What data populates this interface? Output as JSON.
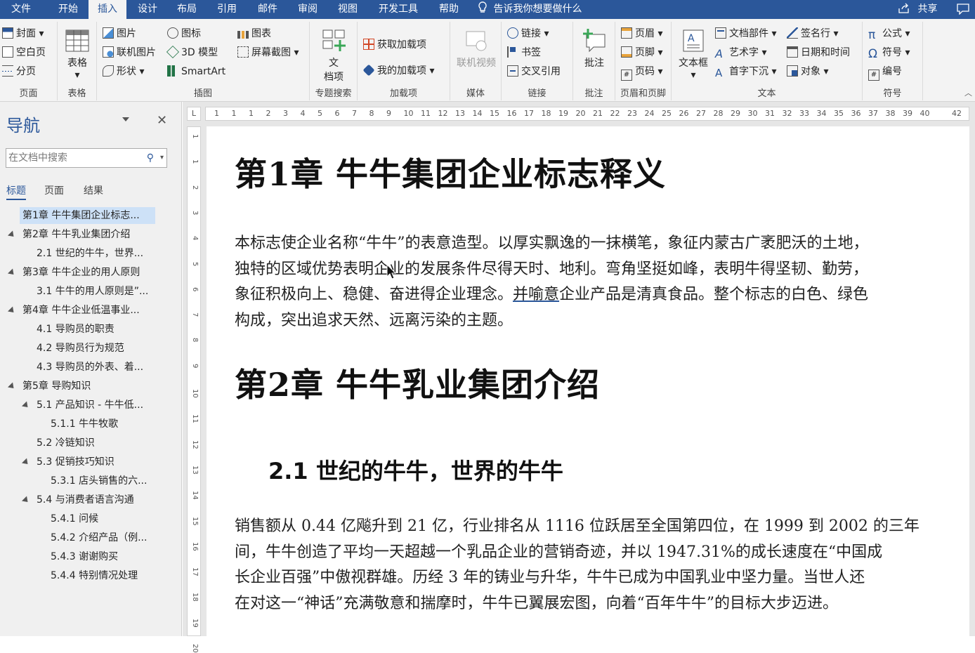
{
  "tabs": [
    {
      "label": "文件"
    },
    {
      "label": "开始"
    },
    {
      "label": "插入"
    },
    {
      "label": "设计"
    },
    {
      "label": "布局"
    },
    {
      "label": "引用"
    },
    {
      "label": "邮件"
    },
    {
      "label": "审阅"
    },
    {
      "label": "视图"
    },
    {
      "label": "开发工具"
    },
    {
      "label": "帮助"
    }
  ],
  "tell_me": "告诉我你想要做什么",
  "share": "共享",
  "ribbon": {
    "pages": {
      "cover": "封面",
      "blank": "空白页",
      "break": "分页",
      "label": "页面"
    },
    "tables": {
      "table": "表格",
      "label": "表格"
    },
    "illustrations": {
      "picture": "图片",
      "online_picture": "联机图片",
      "shapes": "形状",
      "icons": "图标",
      "model3d": "3D 模型",
      "smartart": "SmartArt",
      "chart": "图表",
      "screenshot": "屏幕截图",
      "label": "插图"
    },
    "topic": {
      "doc_item": "文档项",
      "doc_item_line1": "文",
      "doc_item_line2": "档项",
      "label": "专题搜索"
    },
    "addins": {
      "get": "获取加载项",
      "my": "我的加载项",
      "label": "加载项"
    },
    "media": {
      "online_video": "联机视频",
      "label": "媒体"
    },
    "links": {
      "link": "链接",
      "bookmark": "书签",
      "cross_ref": "交叉引用",
      "label": "链接"
    },
    "comments": {
      "comment": "批注",
      "label": "批注"
    },
    "header_footer": {
      "header": "页眉",
      "footer": "页脚",
      "page_number": "页码",
      "label": "页眉和页脚"
    },
    "text": {
      "textbox": "文本框",
      "quick_parts": "文档部件",
      "wordart": "艺术字",
      "dropcap": "首字下沉",
      "signature": "签名行",
      "datetime": "日期和时间",
      "object": "对象",
      "label": "文本"
    },
    "symbols": {
      "equation": "公式",
      "symbol": "符号",
      "number": "编号",
      "label": "符号"
    }
  },
  "nav": {
    "title": "导航",
    "search_placeholder": "在文档中搜索",
    "tabs": [
      "标题",
      "页面",
      "结果"
    ],
    "items": [
      {
        "label": "第1章 牛牛集团企业标志...",
        "level": 1,
        "selected": true,
        "expandable": false
      },
      {
        "label": "第2章 牛牛乳业集团介绍",
        "level": 1,
        "selected": false,
        "expandable": true
      },
      {
        "label": "2.1 世纪的牛牛，世界...",
        "level": 2,
        "selected": false,
        "expandable": false
      },
      {
        "label": "第3章 牛牛企业的用人原则",
        "level": 1,
        "selected": false,
        "expandable": true
      },
      {
        "label": "3.1 牛牛的用人原则是”...",
        "level": 2,
        "selected": false,
        "expandable": false
      },
      {
        "label": "第4章 牛牛企业低温事业...",
        "level": 1,
        "selected": false,
        "expandable": true
      },
      {
        "label": "4.1 导购员的职责",
        "level": 2,
        "selected": false,
        "expandable": false
      },
      {
        "label": "4.2 导购员行为规范",
        "level": 2,
        "selected": false,
        "expandable": false
      },
      {
        "label": "4.3 导购员的外表、着...",
        "level": 2,
        "selected": false,
        "expandable": false
      },
      {
        "label": "第5章 导购知识",
        "level": 1,
        "selected": false,
        "expandable": true
      },
      {
        "label": "5.1 产品知识 - 牛牛低...",
        "level": 2,
        "selected": false,
        "expandable": true
      },
      {
        "label": "5.1.1 牛牛牧歌",
        "level": 3,
        "selected": false,
        "expandable": false
      },
      {
        "label": "5.2 冷链知识",
        "level": 2,
        "selected": false,
        "expandable": false
      },
      {
        "label": "5.3 促销技巧知识",
        "level": 2,
        "selected": false,
        "expandable": true
      },
      {
        "label": "5.3.1 店头销售的六...",
        "level": 3,
        "selected": false,
        "expandable": false
      },
      {
        "label": "5.4 与消费者语言沟通",
        "level": 2,
        "selected": false,
        "expandable": true
      },
      {
        "label": "5.4.1 问候",
        "level": 3,
        "selected": false,
        "expandable": false
      },
      {
        "label": "5.4.2 介绍产品（例...",
        "level": 3,
        "selected": false,
        "expandable": false
      },
      {
        "label": "5.4.3 谢谢购买",
        "level": 3,
        "selected": false,
        "expandable": false
      },
      {
        "label": "5.4.4 特别情况处理",
        "level": 3,
        "selected": false,
        "expandable": false
      }
    ]
  },
  "ruler_h": [
    "1",
    "1",
    "1",
    "2",
    "3",
    "4",
    "5",
    "6",
    "7",
    "8",
    "9",
    "10",
    "11",
    "12",
    "13",
    "14",
    "15",
    "16",
    "17",
    "18",
    "19",
    "20",
    "21",
    "22",
    "23",
    "24",
    "25",
    "26",
    "27",
    "28",
    "29",
    "30",
    "31",
    "32",
    "33",
    "34",
    "35",
    "36",
    "37",
    "38",
    "39",
    "40",
    "42"
  ],
  "ruler_v": [
    "1",
    "1",
    "2",
    "3",
    "4",
    "5",
    "6",
    "7",
    "8",
    "9",
    "10",
    "11",
    "12",
    "13",
    "14",
    "15",
    "16",
    "17",
    "18",
    "19",
    "20"
  ],
  "doc": {
    "h1_chapter1": "第1章  牛牛集团企业标志释义",
    "p1_lines": [
      "本标志使企业名称“牛牛”的表意造型。以厚实飘逸的一抹横笔，象征内蒙古广袤肥沃的土地，",
      "独特的区域优势表明企业的发展条件尽得天时、地利。弯角坚挺如峰，表明牛得坚韧、勤劳，",
      "象征积极向上、稳健、奋进得企业理念。",
      "并喻意",
      "企业产品是清真食品。整个标志的白色、绿色",
      "构成，突出追求天然、远离污染的主题。"
    ],
    "h1_chapter2": "第2章  牛牛乳业集团介绍",
    "h2_section21": "2.1 世纪的牛牛，世界的牛牛",
    "p2_lines": [
      "销售额从 0.44 亿飚升到 21 亿，行业排名从 1116 位跃居至全国第四位，在 1999 到 2002 的三年",
      "间，牛牛创造了平均一天超越一个乳品企业的营销奇迹，并以 1947.31%的成长速度在“中国成",
      "长企业百强”中傲视群雄。历经 3 年的铸业与升华，牛牛已成为中国乳业中坚力量。当世人还",
      "在对这一“神话”充满敬意和揣摩时，牛牛已翼展宏图，向着“百年牛牛”的目标大步迈进。"
    ]
  },
  "colors": {
    "accent": "#2b579a",
    "nav_bg": "#f0f0f0",
    "ribbon_bg": "#f3f3f3",
    "selected": "#cde1f7"
  }
}
